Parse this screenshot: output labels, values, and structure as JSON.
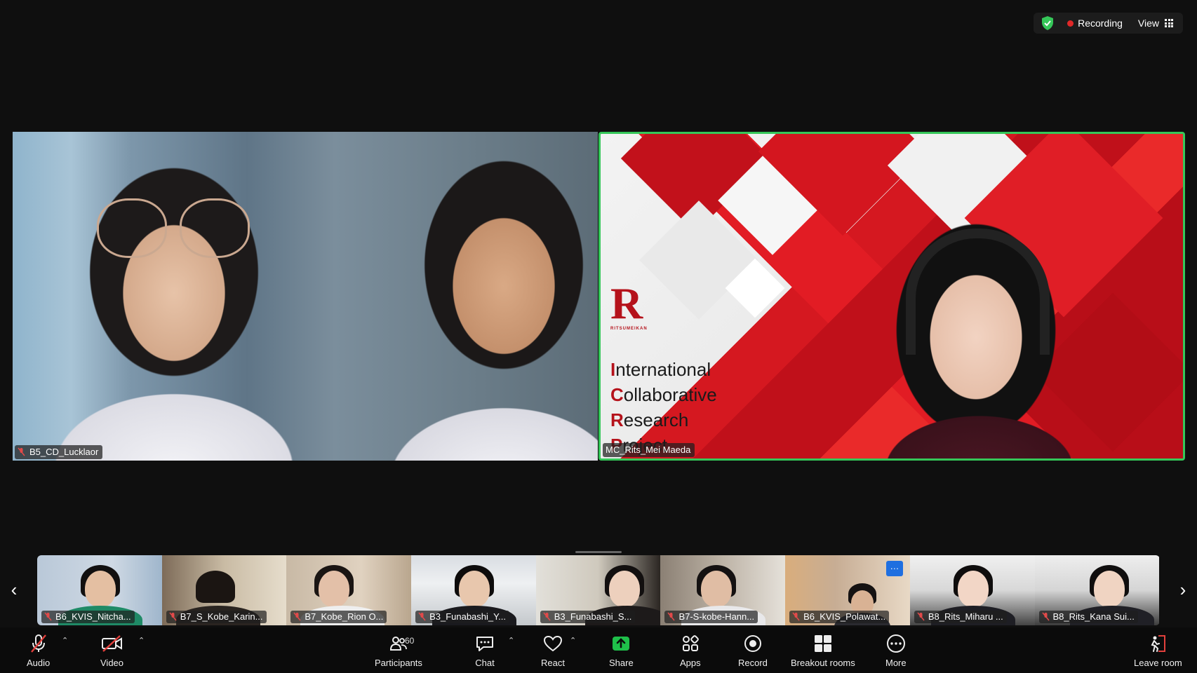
{
  "status": {
    "recording_label": "Recording",
    "view_label": "View",
    "colors": {
      "recording_dot": "#e02828",
      "shield": "#35c759",
      "active_speaker_border": "#35c759"
    }
  },
  "main_tiles": [
    {
      "name": "B5_CD_Lucklaor",
      "muted": true
    },
    {
      "name": "MC_Rits_Mei Maeda",
      "muted": false,
      "active_speaker": true
    }
  ],
  "slide": {
    "logo_letter": "R",
    "logo_sub": "RITSUMEIKAN",
    "lines": [
      {
        "cap": "I",
        "rest": "nternational"
      },
      {
        "cap": "C",
        "rest": "ollaborative"
      },
      {
        "cap": "R",
        "rest": "esearch"
      },
      {
        "cap": "P",
        "rest": "roject"
      }
    ]
  },
  "filmstrip": [
    {
      "name": "B6_KVIS_Nitcha..."
    },
    {
      "name": "B7_S_Kobe_Karin..."
    },
    {
      "name": "B7_Kobe_Rion O..."
    },
    {
      "name": "B3_Funabashi_Y..."
    },
    {
      "name": "B3_Funabashi_S..."
    },
    {
      "name": "B7-S-kobe-Hann..."
    },
    {
      "name": "B6_KVIS_Polawat..."
    },
    {
      "name": "B8_Rits_Miharu ..."
    },
    {
      "name": "B8_Rits_Kana Sui..."
    }
  ],
  "toolbar": {
    "audio": "Audio",
    "video": "Video",
    "participants": "Participants",
    "participants_count": "60",
    "chat": "Chat",
    "react": "React",
    "share": "Share",
    "apps": "Apps",
    "record": "Record",
    "breakout": "Breakout rooms",
    "more": "More",
    "leave": "Leave room"
  },
  "icons": {
    "share_color": "#1fbf4a",
    "thumb_more": "…"
  }
}
